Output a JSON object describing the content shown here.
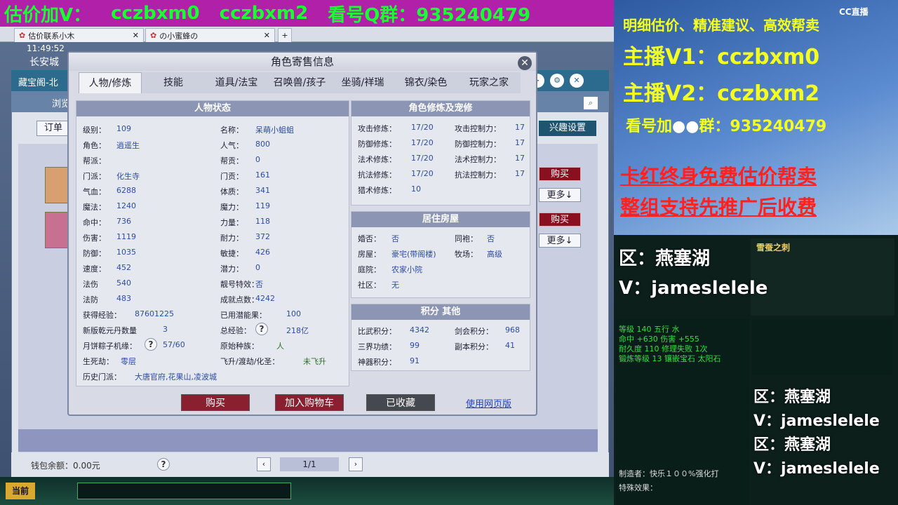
{
  "banner": {
    "text1": "估价加V：",
    "text2": "cczbxm0",
    "text3": "cczbxm2",
    "text4": "看号Q群：935240479"
  },
  "browser_tabs": [
    {
      "label": "估价联系小木"
    },
    {
      "label": "の小蜜蜂の"
    }
  ],
  "game": {
    "clock": "11:49:52",
    "location": "长安城"
  },
  "shop": {
    "title": "藏宝阁-北",
    "tab_browse": "浏览",
    "order_btn": "订单",
    "interest_btn": "兴趣设置",
    "buy_label": "购买",
    "more_label": "更多↓",
    "wallet": "钱包余额：0.00元",
    "page": "1/1"
  },
  "dialog": {
    "title": "角色寄售信息",
    "tabs": [
      "人物/修炼",
      "技能",
      "道具/法宝",
      "召唤兽/孩子",
      "坐骑/祥瑞",
      "锦衣/染色",
      "玩家之家"
    ],
    "char_panel_title": "人物状态",
    "left_col": [
      {
        "k": "级别：",
        "v": "109"
      },
      {
        "k": "角色：",
        "v": "逍遥生"
      },
      {
        "k": "帮派：",
        "v": ""
      },
      {
        "k": "门派：",
        "v": "化生寺"
      },
      {
        "k": "气血：",
        "v": "6288"
      },
      {
        "k": "魔法：",
        "v": "1240"
      },
      {
        "k": "命中：",
        "v": "736"
      },
      {
        "k": "伤害：",
        "v": "1119"
      },
      {
        "k": "防御：",
        "v": "1035"
      },
      {
        "k": "速度：",
        "v": "452"
      },
      {
        "k": "法伤",
        "v": "540"
      },
      {
        "k": "法防",
        "v": "483"
      }
    ],
    "mid_col": [
      {
        "k": "名称：",
        "v": "呆萌小蛆蛆"
      },
      {
        "k": "人气：",
        "v": "800"
      },
      {
        "k": "帮贡：",
        "v": "0"
      },
      {
        "k": "门贡：",
        "v": "161"
      },
      {
        "k": "体质：",
        "v": "341"
      },
      {
        "k": "魔力：",
        "v": "119"
      },
      {
        "k": "力量：",
        "v": "118"
      },
      {
        "k": "耐力：",
        "v": "372"
      },
      {
        "k": "敏捷：",
        "v": "426"
      },
      {
        "k": "潜力：",
        "v": "0"
      },
      {
        "k": "靓号特效：",
        "v": "否"
      },
      {
        "k": "成就点数：",
        "v": "4242"
      }
    ],
    "extra": {
      "exp_k": "获得经验：",
      "exp_v": "87601225",
      "used_pot_k": "已用潜能果：",
      "used_pot_v": "100",
      "qk_k": "新版乾元丹数量",
      "qk_v": "3",
      "total_exp_k": "总经验：",
      "total_exp_v": "218亿",
      "zongzi_k": "月饼粽子机缘：",
      "zongzi_v": "57/60",
      "race_k": "原始种族：",
      "race_v": "人",
      "life_k": "生死劫：",
      "life_v": "零层",
      "fly_k": "飞升/渡劫/化圣：",
      "fly_v": "未飞升",
      "hist_k": "历史门派：",
      "hist_v": "大唐官府,花果山,凌波城",
      "q": "?"
    },
    "cult_title": "角色修炼及宠修",
    "cult_left": [
      {
        "k": "攻击修炼：",
        "v": "17/20"
      },
      {
        "k": "防御修炼：",
        "v": "17/20"
      },
      {
        "k": "法术修炼：",
        "v": "17/20"
      },
      {
        "k": "抗法修炼：",
        "v": "17/20"
      },
      {
        "k": "猎术修炼：",
        "v": "10"
      }
    ],
    "cult_right": [
      {
        "k": "攻击控制力：",
        "v": "17"
      },
      {
        "k": "防御控制力：",
        "v": "17"
      },
      {
        "k": "法术控制力：",
        "v": "17"
      },
      {
        "k": "抗法控制力：",
        "v": "17"
      }
    ],
    "house_title": "居住房屋",
    "house": [
      {
        "k": "婚否：",
        "v": "否",
        "k2": "同袍：",
        "v2": "否"
      },
      {
        "k": "房屋：",
        "v": "豪宅(带阁楼)",
        "k2": "牧场：",
        "v2": "高级"
      },
      {
        "k": "庭院：",
        "v": "农家小院",
        "k2": "",
        "v2": ""
      },
      {
        "k": "社区：",
        "v": "无",
        "k2": "",
        "v2": ""
      }
    ],
    "points_title": "积分 其他",
    "points": [
      {
        "k": "比武积分：",
        "v": "4342",
        "k2": "剑会积分：",
        "v2": "968"
      },
      {
        "k": "三界功绩：",
        "v": "99",
        "k2": "副本积分：",
        "v2": "41"
      },
      {
        "k": "神器积分：",
        "v": "91",
        "k2": "",
        "v2": ""
      }
    ],
    "btn_buy": "购买",
    "btn_cart": "加入购物车",
    "btn_fav": "已收藏",
    "btn_web": "使用网页版"
  },
  "stream": {
    "line1": "明细估价、精准建议、高效帮卖",
    "line2": "主播V1：cczbxm0",
    "line3": "主播V2：cczbxm2",
    "line4": "看号加",
    "line4b": "群：935240479",
    "line5": "卡红终身免费估价帮卖",
    "line6": "整组支持先推广后收费",
    "zone_label": "区：燕塞湖",
    "v_label": "V：jameslelele",
    "brand": "CC直播",
    "item_name": "雪蚕之刺",
    "item_stats": "等级 140  五行 水",
    "item_line2": "命中 +630 伤害 +555",
    "item_line3": "耐久度 110  修理失败 1次",
    "item_line4": "锻炼等级 13  镶嵌宝石 太阳石",
    "maker": "制造者：快乐１００%强化打",
    "effect": "特殊效果："
  },
  "colors": {
    "banner_bg": "#b020a8",
    "banner_fg": "#18ff30",
    "stream_yellow": "#f4ff20",
    "stream_red": "#ff2020",
    "buy_red": "#8a0f1f"
  }
}
